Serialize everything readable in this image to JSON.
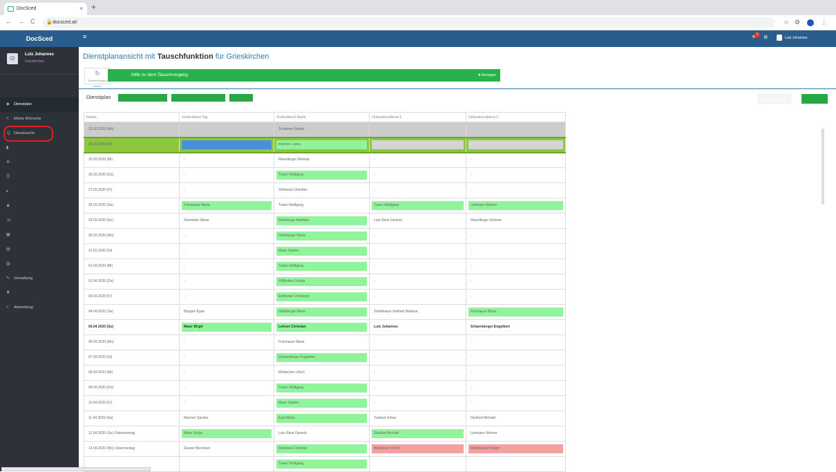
{
  "browser": {
    "tab_title": "DocSced",
    "url": "docsced.at/",
    "close": "×",
    "new_tab": "+",
    "nav": [
      "←",
      "→",
      "C"
    ],
    "lock": "🔒",
    "star": "☆",
    "ext": "⚙",
    "menu": "⋮"
  },
  "sidebar": {
    "brand": "DocSced",
    "user_name": "Lutz Johannes",
    "user_loc": "Grieskirchen",
    "items": [
      {
        "icon": "◆",
        "label": "Dienstplan"
      },
      {
        "icon": "<",
        "label": "Meine Wünsche"
      },
      {
        "icon": "Q",
        "label": "Dienstsuche"
      },
      {
        "icon": "▮",
        "label": ""
      },
      {
        "icon": "⚙",
        "label": ""
      },
      {
        "icon": "☰",
        "label": ""
      },
      {
        "icon": "▸",
        "label": ""
      },
      {
        "icon": "♟",
        "label": ""
      },
      {
        "icon": "☏",
        "label": ""
      },
      {
        "icon": "▦",
        "label": ""
      },
      {
        "icon": "▤",
        "label": ""
      },
      {
        "icon": "▥",
        "label": ""
      },
      {
        "icon": "✎",
        "label": "Verwaltung"
      },
      {
        "icon": "♜",
        "label": ""
      },
      {
        "icon": "<",
        "label": "Abmeldung"
      }
    ]
  },
  "topbar": {
    "hamb": "≡",
    "bell": "⚑",
    "badge": "1",
    "settings": "⚙",
    "user": "Lutz Johannes"
  },
  "main": {
    "title_a": "Dienstplanansicht mit ",
    "title_b": "Tauschfunktion",
    "title_c": " für Grieskirchen",
    "title_sub": "",
    "reload_icon": "↻",
    "reload_label": "Tauschvorgang ändern",
    "help": "Hilfe zu dem Tauschvorgang",
    "help_show": "✚ Anzeigen",
    "dienstplan": "Dienstplan",
    "btn1": "",
    "btn2": "",
    "btn3": "",
    "rb1": "",
    "rb2": ""
  },
  "table": {
    "headers": [
      "Datum",
      "Vorderdienst Tag",
      "Vorderdienst Nacht",
      "Ordinationsdienst 1",
      "Ordinationsdienst 2"
    ],
    "rows": [
      {
        "t": "grey",
        "c": [
          [
            "23.03.2020 (Mo)",
            ""
          ],
          [
            "",
            ""
          ],
          [
            "Schwimm Stefan",
            ""
          ],
          [
            "",
            ""
          ],
          [
            "",
            ""
          ]
        ]
      },
      {
        "t": "sel",
        "c": [
          [
            "24.03.2020 (Di)",
            ""
          ],
          [
            "",
            "b"
          ],
          [
            "Wurmer Lukas",
            "g"
          ],
          [
            "",
            "gr"
          ],
          [
            "",
            "gr"
          ]
        ]
      },
      {
        "t": "",
        "c": [
          [
            "25.03.2020 (Mi)",
            ""
          ],
          [
            "-",
            ""
          ],
          [
            "Waseltinger Dietmar",
            ""
          ],
          [
            "-",
            ""
          ],
          [
            "-",
            ""
          ]
        ]
      },
      {
        "t": "",
        "c": [
          [
            "26.03.2020 (Do)",
            ""
          ],
          [
            "-",
            ""
          ],
          [
            "Tuiser Wolfgang",
            "g"
          ],
          [
            "-",
            ""
          ],
          [
            "-",
            ""
          ]
        ]
      },
      {
        "t": "",
        "c": [
          [
            "27.03.2020 (Fr)",
            ""
          ],
          [
            "-",
            ""
          ],
          [
            "Strihavka Christian",
            ""
          ],
          [
            "-",
            ""
          ],
          [
            "-",
            ""
          ]
        ]
      },
      {
        "t": "",
        "c": [
          [
            "28.03.2020 (Sa)",
            ""
          ],
          [
            "Frischauer Maria",
            "g"
          ],
          [
            "Tuiser Wolfgang",
            ""
          ],
          [
            "Tuiser Wolfgang",
            "g"
          ],
          [
            "Lehmann Werner",
            "g"
          ]
        ]
      },
      {
        "t": "",
        "c": [
          [
            "29.03.2020 (So)",
            ""
          ],
          [
            "Streitsitter Maria",
            ""
          ],
          [
            "Reichmayr Matthias",
            "g"
          ],
          [
            "Lutz-Stein Daniela",
            ""
          ],
          [
            "Waseltinger Dietmar",
            ""
          ]
        ]
      },
      {
        "t": "",
        "c": [
          [
            "30.03.2020 (Mo)",
            ""
          ],
          [
            "-",
            ""
          ],
          [
            "Hießberger Maria",
            "g"
          ],
          [
            "-",
            ""
          ],
          [
            "-",
            ""
          ]
        ]
      },
      {
        "t": "",
        "c": [
          [
            "31.03.2020 (Di)",
            ""
          ],
          [
            "-",
            ""
          ],
          [
            "Maier Sabine",
            "g"
          ],
          [
            "-",
            ""
          ],
          [
            "-",
            ""
          ]
        ]
      },
      {
        "t": "",
        "c": [
          [
            "01.04.2020 (Mi)",
            ""
          ],
          [
            "-",
            ""
          ],
          [
            "Tuiser Wolfgang",
            "g"
          ],
          [
            "-",
            ""
          ],
          [
            "-",
            ""
          ]
        ]
      },
      {
        "t": "",
        "c": [
          [
            "02.04.2020 (Do)",
            ""
          ],
          [
            "-",
            ""
          ],
          [
            "Pöllhuber Christa",
            "g"
          ],
          [
            "-",
            ""
          ],
          [
            "-",
            ""
          ]
        ]
      },
      {
        "t": "",
        "c": [
          [
            "03.04.2020 (Fr)",
            ""
          ],
          [
            "-",
            ""
          ],
          [
            "Endhuber Christoph",
            "g"
          ],
          [
            "-",
            ""
          ],
          [
            "-",
            ""
          ]
        ]
      },
      {
        "t": "",
        "c": [
          [
            "04.04.2020 (Sa)",
            ""
          ],
          [
            "Bangerl Egon",
            ""
          ],
          [
            "Hießberger Maria",
            "g"
          ],
          [
            "Zehetbauer-Seifried Barbara",
            ""
          ],
          [
            "Frischauer Maria",
            "g"
          ]
        ]
      },
      {
        "t": "bold",
        "c": [
          [
            "05.04.2020 (So)",
            ""
          ],
          [
            "Maier Birgit",
            "g"
          ],
          [
            "Lehner Christian",
            "g"
          ],
          [
            "Lutz Johannes",
            ""
          ],
          [
            "Scharnberger Engelbert",
            ""
          ]
        ]
      },
      {
        "t": "",
        "c": [
          [
            "06.04.2020 (Mo)",
            ""
          ],
          [
            "-",
            ""
          ],
          [
            "Frischauer Maria",
            ""
          ],
          [
            "-",
            ""
          ],
          [
            "-",
            ""
          ]
        ]
      },
      {
        "t": "",
        "c": [
          [
            "07.04.2020 (Di)",
            ""
          ],
          [
            "-",
            ""
          ],
          [
            "Scharnberger Engelbert",
            "g"
          ],
          [
            "-",
            ""
          ],
          [
            "-",
            ""
          ]
        ]
      },
      {
        "t": "",
        "c": [
          [
            "08.04.2020 (Mi)",
            ""
          ],
          [
            "-",
            ""
          ],
          [
            "Windecker Ulrich",
            ""
          ],
          [
            "-",
            ""
          ],
          [
            "-",
            ""
          ]
        ]
      },
      {
        "t": "",
        "c": [
          [
            "09.04.2020 (Do)",
            ""
          ],
          [
            "-",
            ""
          ],
          [
            "Tuiser Wolfgang",
            "g"
          ],
          [
            "-",
            ""
          ],
          [
            "-",
            ""
          ]
        ]
      },
      {
        "t": "",
        "c": [
          [
            "10.04.2020 (Fr)",
            ""
          ],
          [
            "-",
            ""
          ],
          [
            "Maier Sabine",
            "g"
          ],
          [
            "-",
            ""
          ],
          [
            "-",
            ""
          ]
        ]
      },
      {
        "t": "",
        "c": [
          [
            "11.04.2020 (Sa)",
            ""
          ],
          [
            "Wurmer Sandra",
            ""
          ],
          [
            "Essl Maria",
            "g"
          ],
          [
            "Tuckner Elmar",
            ""
          ],
          [
            "Gleißert Michael",
            ""
          ]
        ]
      },
      {
        "t": "",
        "c": [
          [
            "12.04.2020 (So) Ostersonntag",
            ""
          ],
          [
            "Maier Sonja",
            "g"
          ],
          [
            "Lutz-Stein Daniela",
            ""
          ],
          [
            "Gleißert Michael",
            "g"
          ],
          [
            "Lehmann Werner",
            ""
          ]
        ]
      },
      {
        "t": "",
        "c": [
          [
            "13.04.2020 (Mo) Ostermontag",
            ""
          ],
          [
            "Zauner Bernhard",
            ""
          ],
          [
            "Strihavka Christian",
            "g"
          ],
          [
            "Windecker Ulrich",
            "r"
          ],
          [
            "Windeckster Ralph",
            "r"
          ]
        ]
      },
      {
        "t": "",
        "c": [
          [
            "",
            ""
          ],
          [
            "",
            ""
          ],
          [
            "Tuiser Wolfgang",
            "g"
          ],
          [
            "",
            ""
          ],
          [
            "",
            ""
          ]
        ]
      }
    ]
  },
  "status": ""
}
